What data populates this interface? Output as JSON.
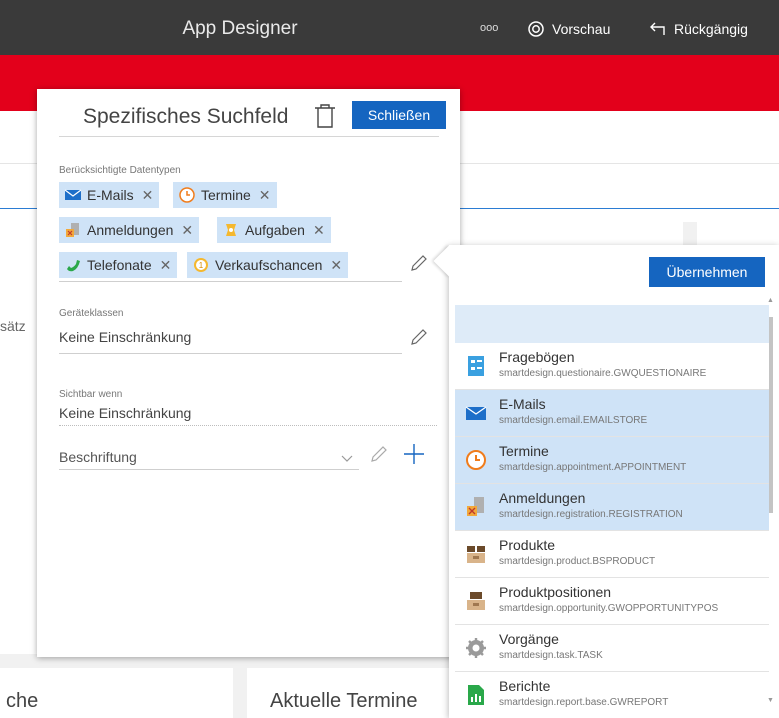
{
  "topbar": {
    "title": "App Designer",
    "dots": "ooo",
    "preview_label": "Vorschau",
    "undo_label": "Rückgängig"
  },
  "background": {
    "side_text": "sätz",
    "bottom_left_text": "che",
    "bottom_right_text": "Aktuelle Termine"
  },
  "popup": {
    "title": "Spezifisches Suchfeld",
    "close_label": "Schließen",
    "datatypes_label": "Berücksichtigte Datentypen",
    "chips": [
      {
        "label": "E-Mails",
        "icon": "mail-icon"
      },
      {
        "label": "Termine",
        "icon": "appointment-icon"
      },
      {
        "label": "Anmeldungen",
        "icon": "registration-icon"
      },
      {
        "label": "Aufgaben",
        "icon": "task-icon"
      },
      {
        "label": "Telefonate",
        "icon": "phone-icon"
      },
      {
        "label": "Verkaufschancen",
        "icon": "opportunity-icon"
      }
    ],
    "device_label": "Geräteklassen",
    "device_value": "Keine Einschränkung",
    "visible_label": "Sichtbar wenn",
    "visible_value": "Keine Einschränkung",
    "caption_placeholder": "Beschriftung"
  },
  "panel": {
    "apply_label": "Übernehmen",
    "items": [
      {
        "name": "Fragebögen",
        "id": "smartdesign.questionaire.GWQUESTIONAIRE",
        "selected": false,
        "icon": "questionnaire-icon"
      },
      {
        "name": "E-Mails",
        "id": "smartdesign.email.EMAILSTORE",
        "selected": true,
        "icon": "mail-icon"
      },
      {
        "name": "Termine",
        "id": "smartdesign.appointment.APPOINTMENT",
        "selected": true,
        "icon": "appointment-icon"
      },
      {
        "name": "Anmeldungen",
        "id": "smartdesign.registration.REGISTRATION",
        "selected": true,
        "icon": "registration-icon"
      },
      {
        "name": "Produkte",
        "id": "smartdesign.product.BSPRODUCT",
        "selected": false,
        "icon": "product-icon"
      },
      {
        "name": "Produktpositionen",
        "id": "smartdesign.opportunity.GWOPPORTUNITYPOS",
        "selected": false,
        "icon": "product-position-icon"
      },
      {
        "name": "Vorgänge",
        "id": "smartdesign.task.TASK",
        "selected": false,
        "icon": "gear-icon"
      },
      {
        "name": "Berichte",
        "id": "smartdesign.report.base.GWREPORT",
        "selected": false,
        "icon": "report-icon"
      }
    ]
  },
  "colors": {
    "topbar": "#3a3a3a",
    "red": "#e3001b",
    "accent": "#1565c0",
    "selection": "#cfe3f7"
  }
}
